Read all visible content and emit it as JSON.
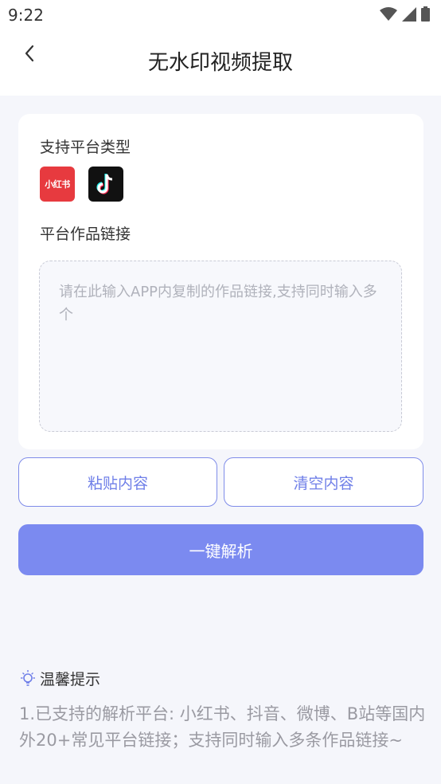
{
  "status_bar": {
    "time": "9:22"
  },
  "header": {
    "title": "无水印视频提取"
  },
  "card": {
    "platforms_label": "支持平台类型",
    "platforms": [
      {
        "name": "小红书",
        "icon": "xiaohongshu-logo"
      },
      {
        "name": "抖音",
        "icon": "douyin-logo"
      }
    ],
    "link_label": "平台作品链接",
    "link_input": {
      "value": "",
      "placeholder": "请在此输入APP内复制的作品链接,支持同时输入多个"
    }
  },
  "actions": {
    "paste_label": "粘贴内容",
    "clear_label": "清空内容",
    "parse_label": "一键解析"
  },
  "tips": {
    "title": "温馨提示",
    "text": "1.已支持的解析平台: 小红书、抖音、微博、B站等国内外20+常见平台链接；支持同时输入多条作品链接~"
  },
  "colors": {
    "accent": "#7b8af0",
    "outline": "#7f8ce9",
    "xiaohongshu": "#e73a3f"
  }
}
